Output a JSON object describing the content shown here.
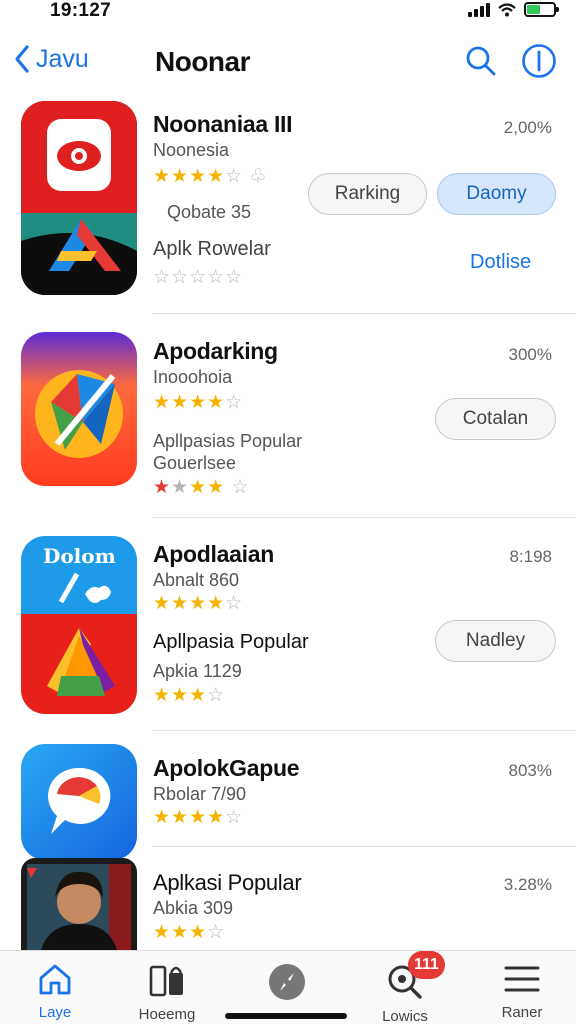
{
  "status_bar": {
    "time": "19:127"
  },
  "nav": {
    "back_label": "Javu",
    "title": "Noonar"
  },
  "apps": [
    {
      "name": "Noonaniaa III",
      "subtitle": "Noonesia",
      "count": "2,00%",
      "rating_text": "Qobate 35",
      "secondary_name": "Aplk Rowelar",
      "buttons": [
        "Rarking",
        "Daomy"
      ],
      "link": "Dotlise"
    },
    {
      "name": "Apodarking",
      "subtitle": "Inooohoia",
      "count": "300%",
      "detail_line1": "Apllpasias Popular",
      "detail_line2": "Gouerlsee",
      "button": "Cotalan"
    },
    {
      "name": "Apodlaaian",
      "subtitle": "Abnalt 860",
      "count": "8:198",
      "icon_text": "Dolom",
      "secondary_name": "Apllpasia Popular",
      "secondary_sub": "Apkia 1129",
      "button": "Nadley"
    },
    {
      "name": "ApolokGapue",
      "subtitle": "Rbolar 7/90",
      "count": "803%"
    },
    {
      "name": "Aplkasi Popular",
      "subtitle": "Abkia 309",
      "count": "3.28%"
    }
  ],
  "tabs": [
    {
      "label": "Laye",
      "icon": "home-icon"
    },
    {
      "label": "Hoeemg",
      "icon": "bag-icon"
    },
    {
      "label": "",
      "icon": "compass-icon"
    },
    {
      "label": "Lowics",
      "icon": "search-icon",
      "badge": "111"
    },
    {
      "label": "Raner",
      "icon": "menu-icon"
    }
  ]
}
